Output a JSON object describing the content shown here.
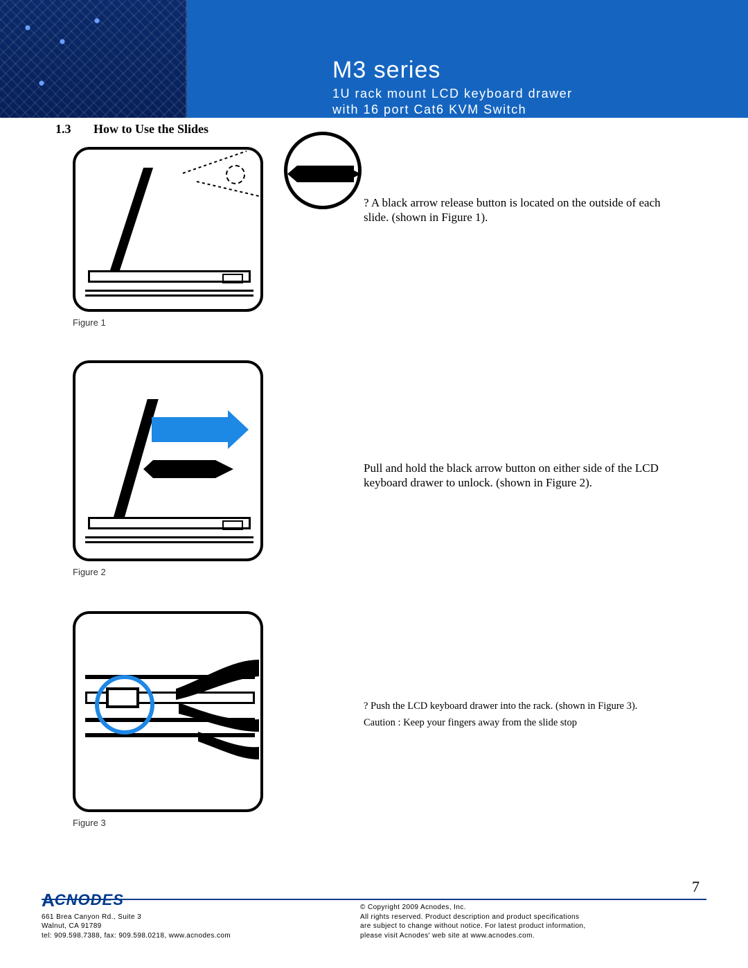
{
  "header": {
    "title": "M3 series",
    "subtitle1": "1U rack mount LCD keyboard drawer",
    "subtitle2": "with 16 port Cat6 KVM Switch"
  },
  "section": {
    "number": "1.3",
    "title": "How to Use the Slides"
  },
  "figures": {
    "f1": {
      "caption": "Figure 1",
      "desc": "? A black arrow release button is located on the outside of each slide. (shown in Figure 1)."
    },
    "f2": {
      "caption": "Figure 2",
      "desc": "Pull and hold the black arrow button on either side of the LCD keyboard drawer to unlock. (shown in Figure 2)."
    },
    "f3": {
      "caption": "Figure 3",
      "desc_line1": "? Push the LCD keyboard drawer into the rack. (shown in Figure 3).",
      "desc_line2": "Caution : Keep your fingers away from the slide stop"
    }
  },
  "page_number": "7",
  "footer": {
    "logo": "CNODES",
    "addr1": "661 Brea Canyon Rd., Suite 3",
    "addr2": "Walnut, CA 91789",
    "addr3": "tel: 909.598.7388, fax: 909.598.0218, www.acnodes.com",
    "copy1": "© Copyright 2009 Acnodes, Inc.",
    "copy2": "All rights reserved. Product description and product specifications",
    "copy3": "are subject to change without notice. For latest product information,",
    "copy4": "please visit Acnodes' web site at www.acnodes.com."
  }
}
